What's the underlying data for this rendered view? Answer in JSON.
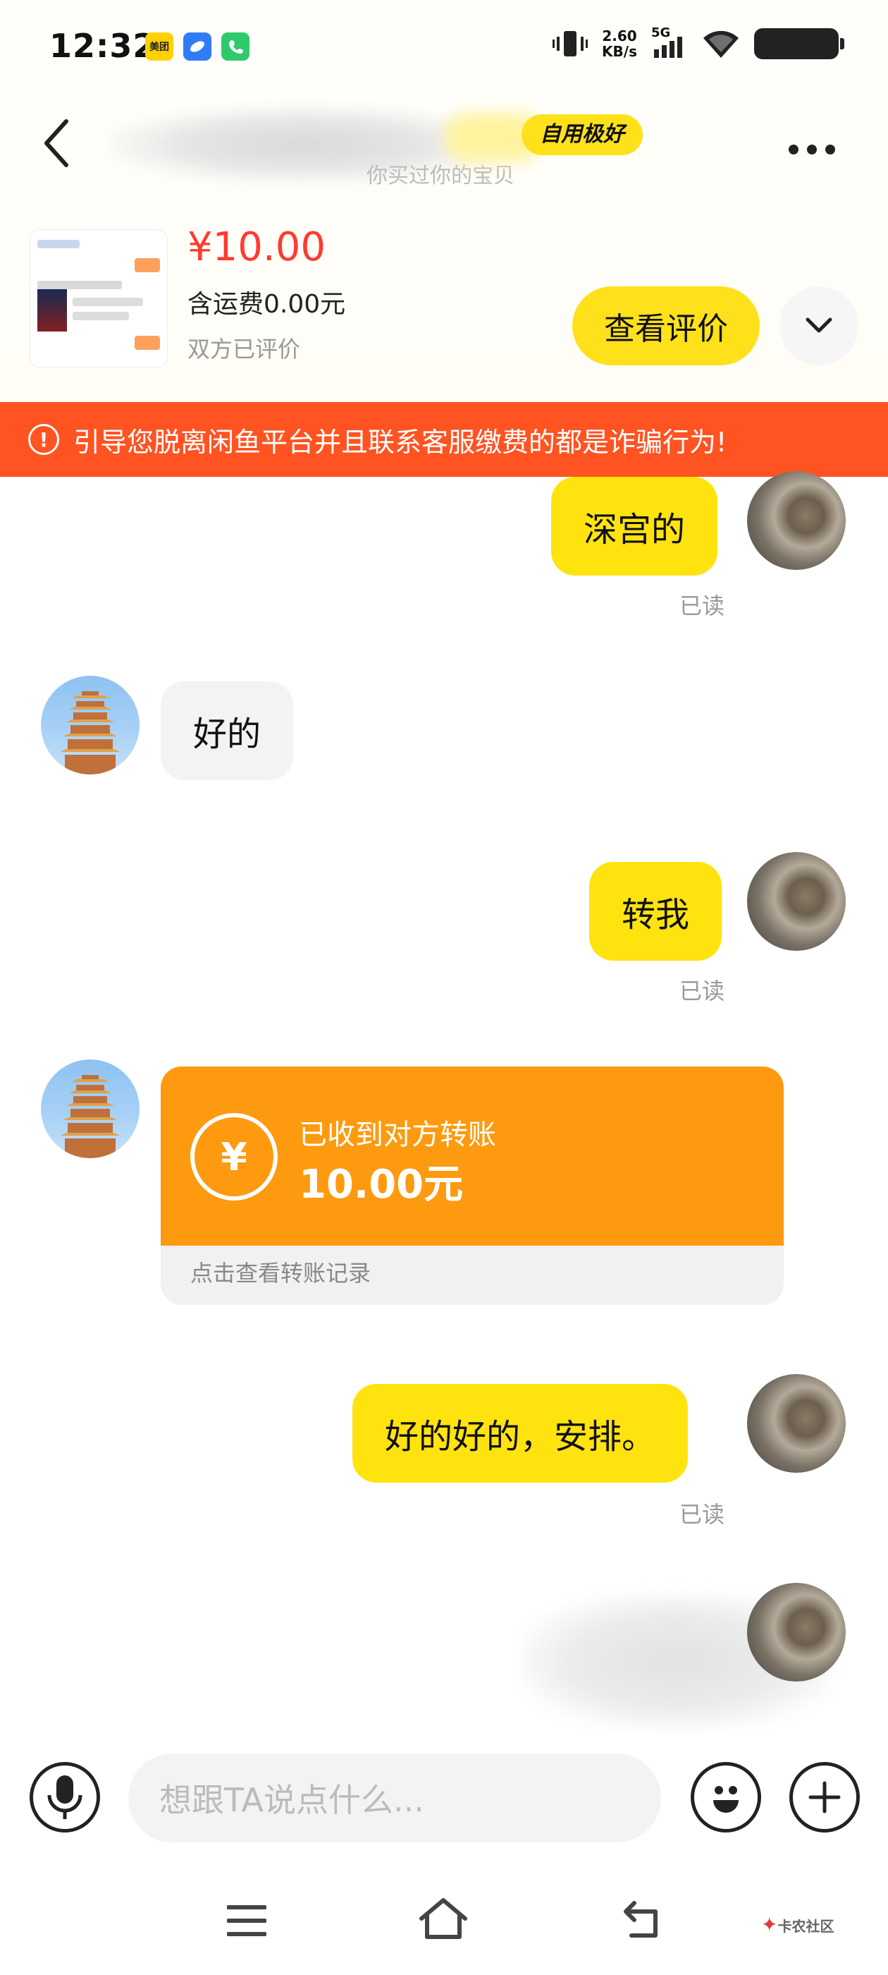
{
  "status_bar": {
    "time": "12:32",
    "app_badge_1": "美团",
    "net_speed_value": "2.60",
    "net_speed_unit": "KB/s",
    "network": "5G"
  },
  "header": {
    "badge": "自用极好",
    "subtitle": "你买过你的宝贝"
  },
  "product": {
    "price": "¥10.00",
    "shipping": "含运费0.00元",
    "status": "双方已评价",
    "review_button": "查看评价"
  },
  "warning": {
    "icon": "!",
    "text": "引导您脱离闲鱼平台并且联系客服缴费的都是诈骗行为!"
  },
  "messages": {
    "m1": {
      "text": "深宫的",
      "status": "已读"
    },
    "m2": {
      "text": "好的"
    },
    "m3": {
      "text": "转我",
      "status": "已读"
    },
    "transfer": {
      "label": "已收到对方转账",
      "amount": "10.00元",
      "link": "点击查看转账记录",
      "icon": "¥"
    },
    "m4": {
      "text": "好的好的，安排。",
      "status": "已读"
    }
  },
  "input_bar": {
    "placeholder": "想跟TA说点什么..."
  },
  "watermark": "卡农社区",
  "colors": {
    "accent_yellow": "#FFE30F",
    "warning_orange": "#FF5322",
    "transfer_orange": "#FD9A0F",
    "price_red": "#FF3B30"
  }
}
